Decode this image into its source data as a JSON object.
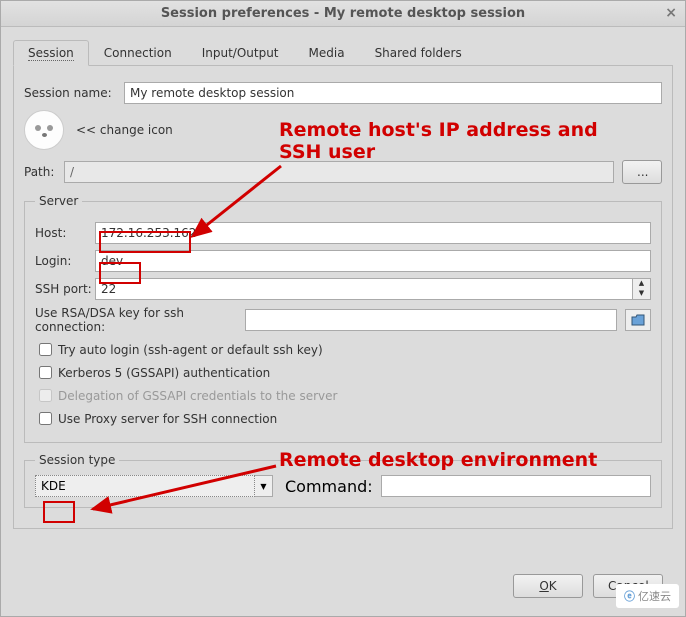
{
  "window": {
    "title": "Session preferences - My remote desktop session"
  },
  "tabs": [
    "Session",
    "Connection",
    "Input/Output",
    "Media",
    "Shared folders"
  ],
  "session": {
    "name_label": "Session name:",
    "name_value": "My remote desktop session",
    "change_icon": "<< change icon",
    "path_label": "Path:",
    "path_value": "/",
    "browse": "..."
  },
  "server": {
    "legend": "Server",
    "host_label": "Host:",
    "host_value": "172.16.253.162",
    "login_label": "Login:",
    "login_value": "dev",
    "sshport_label": "SSH port:",
    "sshport_value": "22",
    "rsa_label": "Use RSA/DSA key for ssh connection:",
    "rsa_value": "",
    "cb1": "Try auto login (ssh-agent or default ssh key)",
    "cb2": "Kerberos 5 (GSSAPI) authentication",
    "cb3": "Delegation of GSSAPI credentials to the server",
    "cb4": "Use Proxy server for SSH connection"
  },
  "session_type": {
    "legend": "Session type",
    "value": "KDE",
    "command_label": "Command:",
    "command_value": ""
  },
  "actions": {
    "ok": "OK",
    "cancel": "Cancel"
  },
  "annotations": {
    "a1_line1": "Remote host's IP address and",
    "a1_line2": "SSH user",
    "a2": "Remote desktop environment"
  },
  "watermark": "亿速云"
}
